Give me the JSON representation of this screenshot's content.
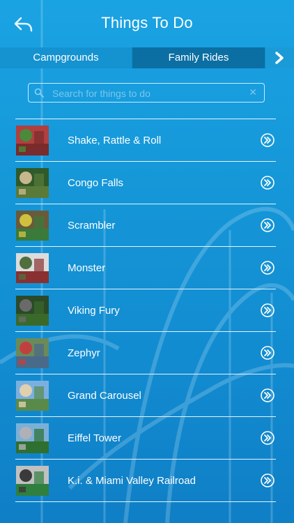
{
  "header": {
    "title": "Things To Do",
    "back_icon": "back-arrow-icon"
  },
  "tabs": [
    {
      "label": "Campgrounds",
      "selected": false
    },
    {
      "label": "Family Rides",
      "selected": true
    }
  ],
  "tabs_more_icon": "chevron-right-icon",
  "search": {
    "placeholder": "Search for things to do",
    "value": ""
  },
  "items": [
    {
      "label": "Shake, Rattle & Roll",
      "thumb": "ride-photo",
      "colors": [
        "#7a2b2b",
        "#4a8a3a",
        "#b04040"
      ]
    },
    {
      "label": "Congo Falls",
      "thumb": "ride-photo",
      "colors": [
        "#5a7a3a",
        "#c9b68e",
        "#2f5a2a"
      ]
    },
    {
      "label": "Scrambler",
      "thumb": "ride-photo",
      "colors": [
        "#3a7a3a",
        "#d0c040",
        "#6a5a3a"
      ]
    },
    {
      "label": "Monster",
      "thumb": "ride-photo",
      "colors": [
        "#8a3030",
        "#4f6f3f",
        "#dcdcdc"
      ]
    },
    {
      "label": "Viking Fury",
      "thumb": "ride-photo",
      "colors": [
        "#3a6a2a",
        "#6a6a6a",
        "#2a4a2a"
      ]
    },
    {
      "label": "Zephyr",
      "thumb": "ride-photo",
      "colors": [
        "#4a6a8a",
        "#c04040",
        "#6a8a5a"
      ]
    },
    {
      "label": "Grand Carousel",
      "thumb": "ride-photo",
      "colors": [
        "#5a8a4a",
        "#e0d0b0",
        "#7ab0e0"
      ]
    },
    {
      "label": "Eiffel Tower",
      "thumb": "ride-photo",
      "colors": [
        "#2f6f2f",
        "#b0b0b8",
        "#7ab0d8"
      ]
    },
    {
      "label": "K.i. & Miami Valley Railroad",
      "thumb": "ride-photo",
      "colors": [
        "#2f7f3f",
        "#3a3a3a",
        "#c0c0c0"
      ]
    }
  ]
}
